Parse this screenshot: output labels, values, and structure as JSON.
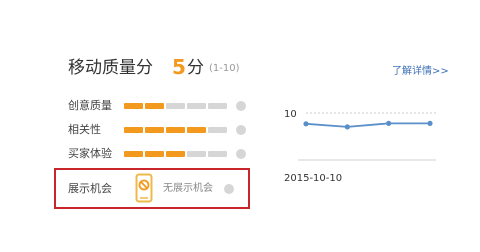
{
  "header": {
    "title": "移动质量分",
    "score": "5",
    "unit": "分",
    "range": "(1-10)",
    "more_link": "了解详情>>"
  },
  "metrics": [
    {
      "label": "创意质量",
      "level": 0.4
    },
    {
      "label": "相关性",
      "level": 0.8
    },
    {
      "label": "买家体验",
      "level": 0.6
    }
  ],
  "display": {
    "label": "展示机会",
    "icon": "phone-no-display-icon",
    "status": "无展示机会"
  },
  "chart_data": {
    "type": "line",
    "x": [
      "2015-10-10"
    ],
    "series": [
      {
        "values": [
          7.6,
          6.9,
          7.7,
          7.7
        ]
      }
    ],
    "y_tick": "10",
    "x_tick": "2015-10-10",
    "ylim": [
      0,
      10
    ],
    "grid": false
  },
  "colors": {
    "accent": "#f39a1e",
    "bar_off": "#d6d6d6",
    "line": "#5a8fc9",
    "highlight": "#c9262b",
    "link": "#3d6fb6"
  }
}
